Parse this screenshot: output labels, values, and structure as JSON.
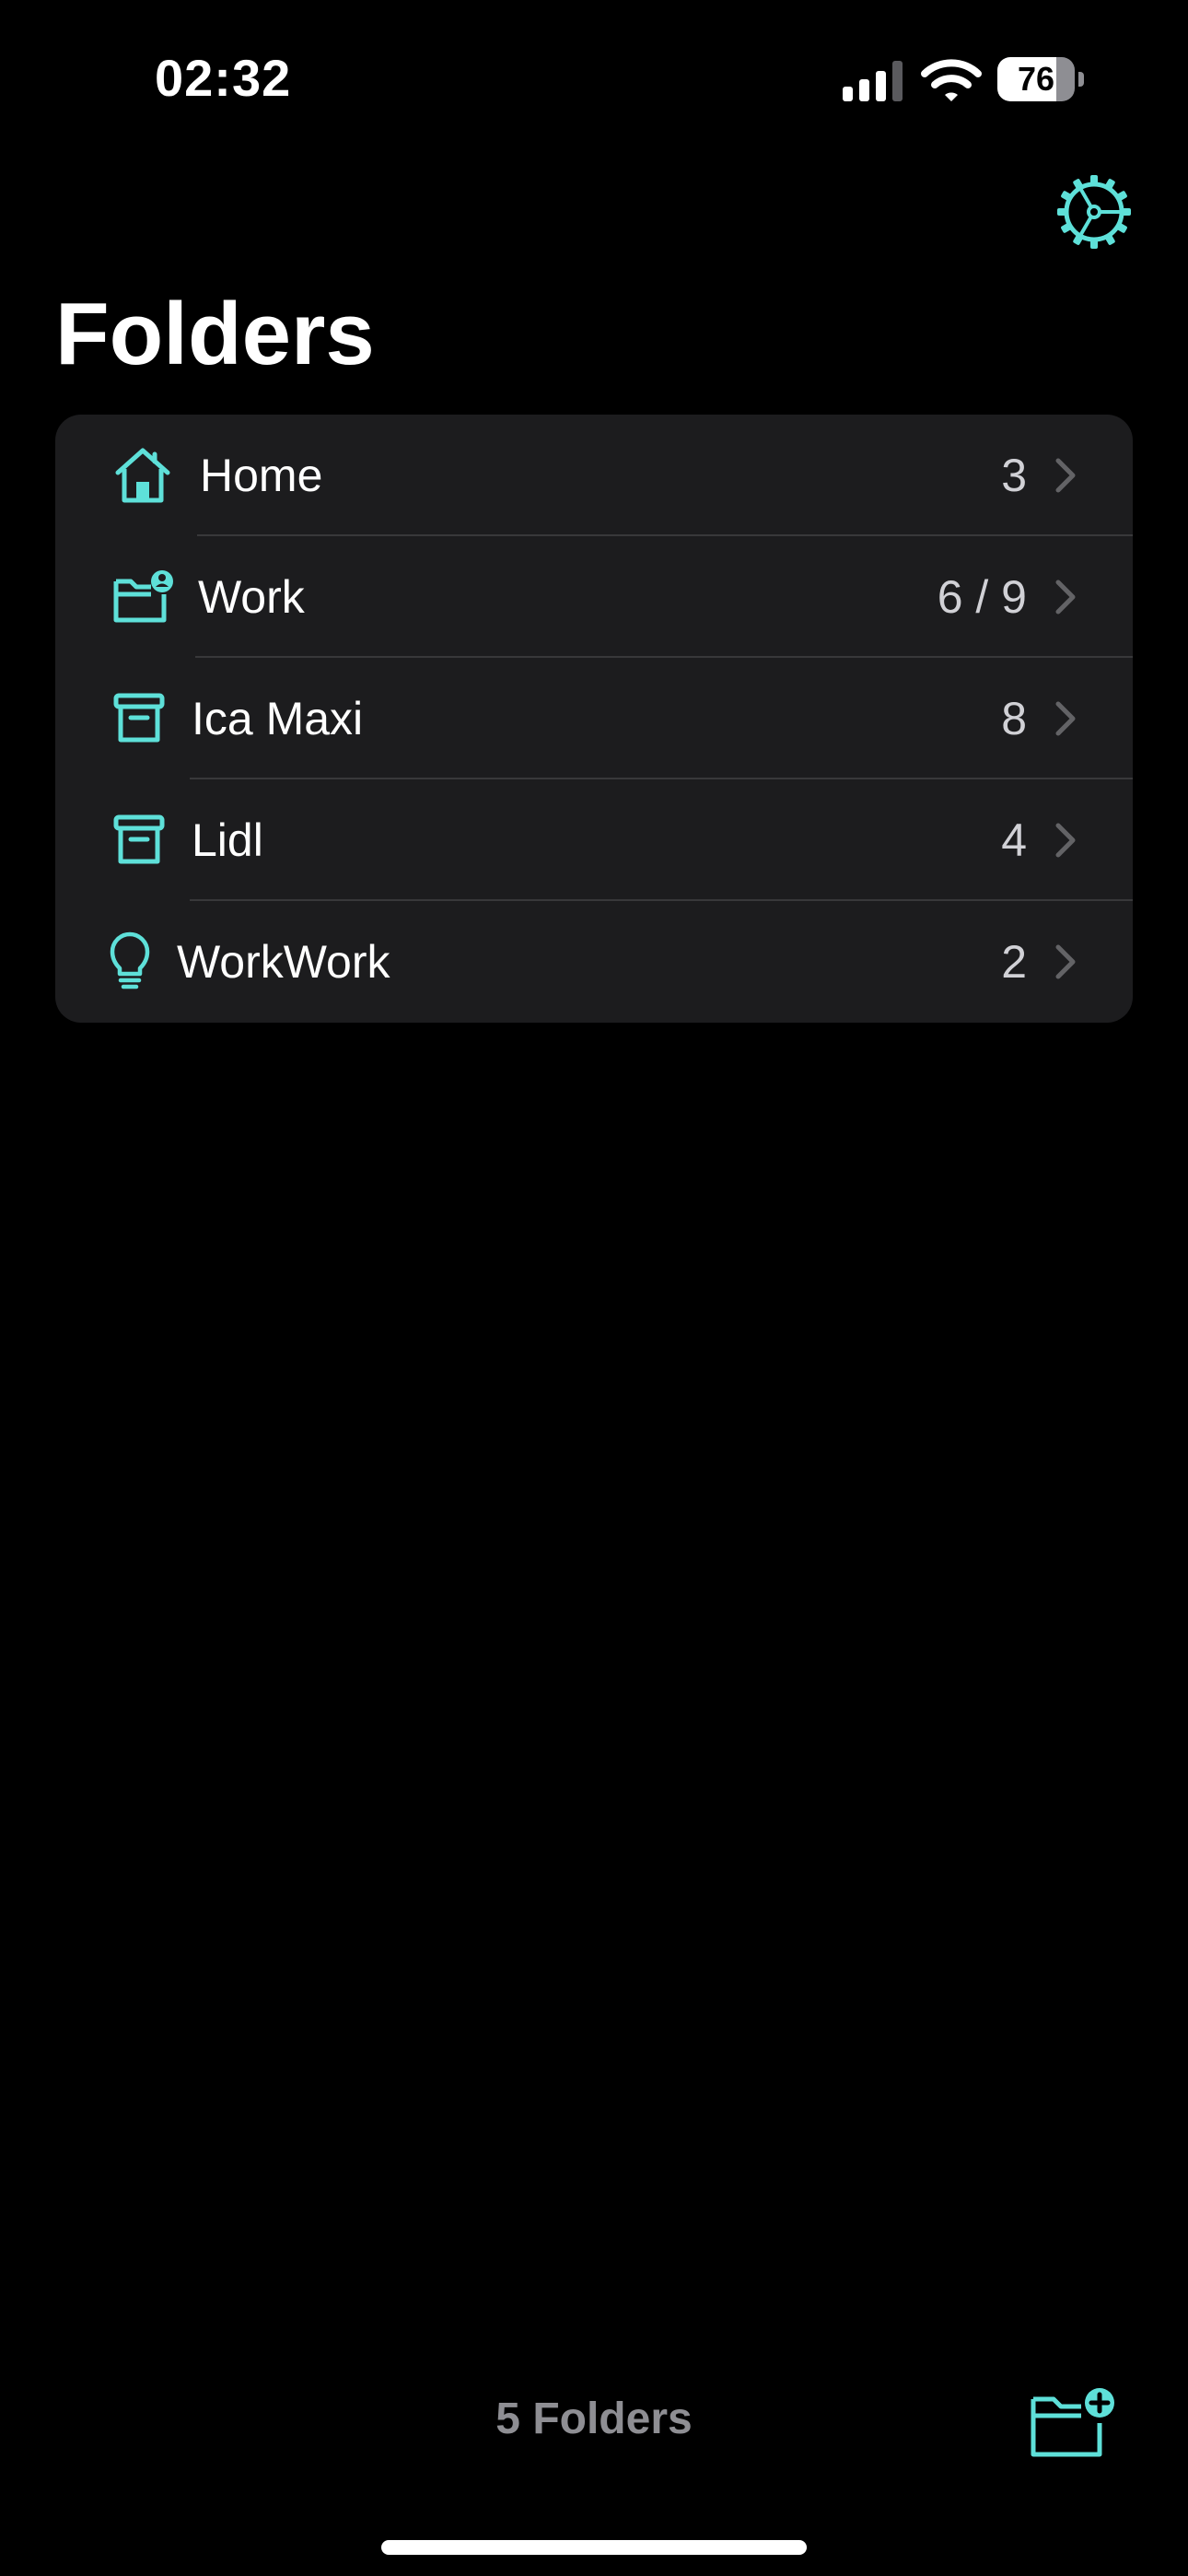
{
  "status_bar": {
    "time": "02:32",
    "battery_level": "76",
    "battery_fraction": 0.76
  },
  "header": {
    "settings_icon": "gear-icon",
    "title": "Folders"
  },
  "folders": [
    {
      "icon": "house-icon",
      "name": "Home",
      "count": "3"
    },
    {
      "icon": "folder-person-icon",
      "name": "Work",
      "count": "6 / 9"
    },
    {
      "icon": "archive-box-icon",
      "name": "Ica Maxi",
      "count": "8"
    },
    {
      "icon": "archive-box-icon",
      "name": "Lidl",
      "count": "4"
    },
    {
      "icon": "lightbulb-icon",
      "name": "WorkWork",
      "count": "2"
    }
  ],
  "footer": {
    "folder_count_label": "5 Folders",
    "new_folder_icon": "folder-plus-icon"
  },
  "colors": {
    "accent": "#5ee0d9",
    "background": "#000000",
    "card": "#1c1c1e",
    "separator": "#38383a",
    "secondary_text": "#8e8e93"
  }
}
